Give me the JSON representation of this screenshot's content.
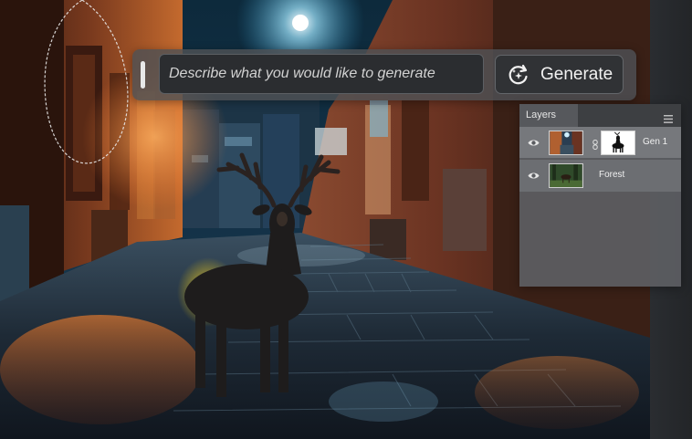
{
  "prompt_bar": {
    "placeholder": "Describe what you would like to generate",
    "generate_label": "Generate",
    "generate_icon": "sparkle-refresh-icon"
  },
  "layers_panel": {
    "title": "Layers",
    "menu_icon": "panel-menu-icon",
    "layers": [
      {
        "name": "Gen 1",
        "visible": true,
        "has_mask": true,
        "selected": true
      },
      {
        "name": "Forest",
        "visible": true,
        "has_mask": false,
        "selected": false
      }
    ]
  },
  "colors": {
    "panel_bg": "#5c5e62",
    "input_bg": "#2b2d30",
    "text": "#f2f2f2"
  }
}
